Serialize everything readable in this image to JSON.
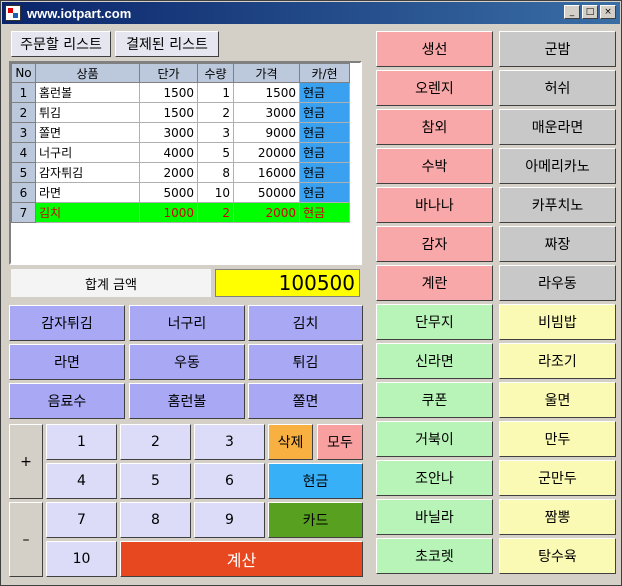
{
  "window": {
    "title": "www.iotpart.com",
    "controls": {
      "minimize": "_",
      "maximize": "□",
      "close": "×"
    }
  },
  "tabs": {
    "order_list": "주문할 리스트",
    "paid_list": "결제된 리스트"
  },
  "table": {
    "headers": [
      "No",
      "상품",
      "단가",
      "수량",
      "가격",
      "카/현"
    ],
    "rows": [
      {
        "no": "1",
        "product": "홈런볼",
        "price": "1500",
        "qty": "1",
        "amount": "1500",
        "pay": "현금"
      },
      {
        "no": "2",
        "product": "튀김",
        "price": "1500",
        "qty": "2",
        "amount": "3000",
        "pay": "현금"
      },
      {
        "no": "3",
        "product": "쫄면",
        "price": "3000",
        "qty": "3",
        "amount": "9000",
        "pay": "현금"
      },
      {
        "no": "4",
        "product": "너구리",
        "price": "4000",
        "qty": "5",
        "amount": "20000",
        "pay": "현금"
      },
      {
        "no": "5",
        "product": "감자튀김",
        "price": "2000",
        "qty": "8",
        "amount": "16000",
        "pay": "현금"
      },
      {
        "no": "6",
        "product": "라면",
        "price": "5000",
        "qty": "10",
        "amount": "50000",
        "pay": "현금"
      },
      {
        "no": "7",
        "product": "김치",
        "price": "1000",
        "qty": "2",
        "amount": "2000",
        "pay": "현금"
      }
    ]
  },
  "total": {
    "label": "합계 금액",
    "value": "100500"
  },
  "categories": [
    "감자튀김",
    "너구리",
    "김치",
    "라면",
    "우동",
    "튀김",
    "음료수",
    "홈런볼",
    "쫄면"
  ],
  "keypad": {
    "plus": "+",
    "minus": "–",
    "digits": [
      "1",
      "2",
      "3",
      "4",
      "5",
      "6",
      "7",
      "8",
      "9",
      "10"
    ],
    "delete": "삭제",
    "all": "모두",
    "cash": "현금",
    "card": "카드",
    "calculate": "계산"
  },
  "menu": {
    "col1": [
      "생선",
      "오렌지",
      "참외",
      "수박",
      "바나나",
      "감자",
      "계란",
      "단무지",
      "신라면",
      "쿠폰",
      "거북이",
      "조안나",
      "바닐라",
      "초코렛"
    ],
    "col2": [
      "군밤",
      "허쉬",
      "매운라면",
      "아메리카노",
      "카푸치노",
      "짜장",
      "라우동",
      "비빔밥",
      "라조기",
      "울면",
      "만두",
      "군만두",
      "짬뽕",
      "탕수육"
    ]
  },
  "colors": {
    "title_bar": "#0a246a",
    "category": "#a8a8f4",
    "menu_pink": "#f8a8a8",
    "menu_grey": "#c8c8c8",
    "menu_green": "#b8f4b8",
    "menu_yellow": "#fafab4",
    "cash_cell": "#3aa0f0",
    "selected_row": "#00ff00",
    "total_bg": "#ffff00",
    "delete_btn": "#f8b040",
    "all_btn": "#f8a0a0",
    "cash_btn": "#38b0f8",
    "card_btn": "#58a020",
    "calc_btn": "#e84820"
  }
}
